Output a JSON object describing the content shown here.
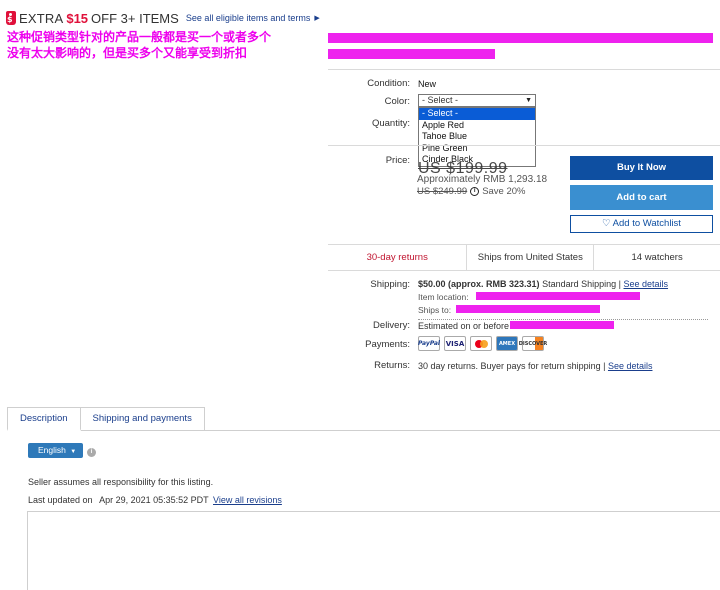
{
  "promo": {
    "text_prefix": "EXTRA",
    "amount": "$15",
    "text_suffix": "OFF 3+ ITEMS",
    "link": "See all eligible items and terms",
    "amount_color": "#e0103a"
  },
  "annotation": {
    "line1": "这种促销类型针对的产品一般都是买一个或者多个",
    "line2": "没有太大影响的，但是买多个又能享受到折扣"
  },
  "item": {
    "condition_label": "Condition:",
    "condition_value": "New",
    "color_label": "Color:",
    "color_selected": "- Select -",
    "color_options": [
      "- Select -",
      "Apple Red",
      "Tahoe Blue",
      "Pine Green",
      "Cinder Black"
    ],
    "quantity_label": "Quantity:",
    "price_label": "Price:",
    "price_obscured": "US $199.99",
    "approx": "Approximately RMB 1,293.18",
    "was_price": "US $249.99",
    "save": "Save 20%"
  },
  "buttons": {
    "buy": "Buy It Now",
    "cart": "Add to cart",
    "watch": "♡ Add to Watchlist",
    "buy_color": "#0e4fa1",
    "cart_color": "#3a8fd0"
  },
  "badges": {
    "returns": "30-day returns",
    "ships": "Ships from United States",
    "watchers": "14 watchers"
  },
  "shipping": {
    "label": "Shipping:",
    "cost": "$50.00 (approx. RMB 323.31)",
    "method": "Standard Shipping |",
    "details_link": "See details",
    "location_label": "Item location:",
    "ships_to_label": "Ships to:",
    "delivery_label": "Delivery:",
    "delivery_text": "Estimated on or before",
    "payments_label": "Payments:",
    "returns_label": "Returns:",
    "returns_text": "30 day returns. Buyer pays for return shipping |",
    "returns_link": "See details"
  },
  "payment_icons": [
    "paypal-icon",
    "visa-icon",
    "mastercard-icon",
    "amex-icon",
    "discover-icon"
  ],
  "payment_text": {
    "paypal": "PayPal",
    "visa": "VISA",
    "amex": "AMEX",
    "discover": "DISCOVER"
  },
  "tabs": [
    "Description",
    "Shipping and payments"
  ],
  "description": {
    "language": "English",
    "seller_note": "Seller assumes all responsibility for this listing.",
    "updated_label": "Last updated on",
    "updated_value": "Apr 29, 2021 05:35:52 PDT",
    "revisions_link": "View all revisions"
  }
}
